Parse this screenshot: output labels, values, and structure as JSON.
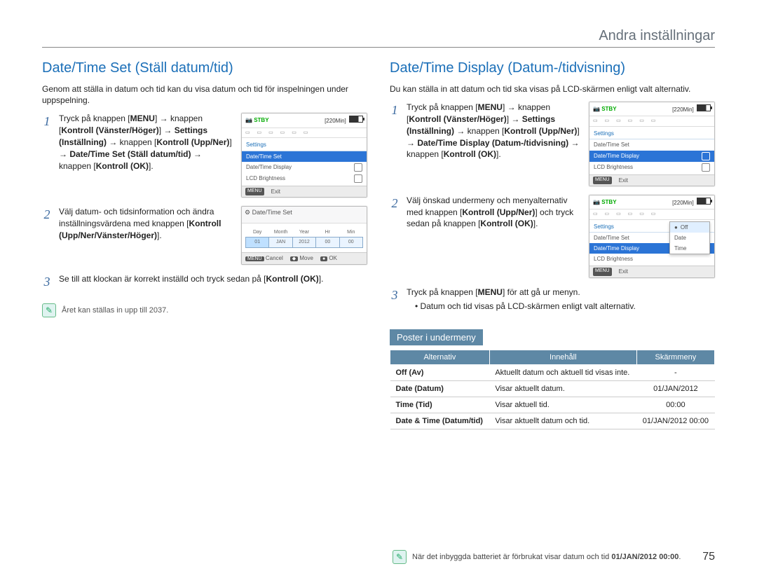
{
  "header": {
    "title": "Andra inställningar"
  },
  "page_number": "75",
  "left": {
    "heading": "Date/Time Set (Ställ datum/tid)",
    "intro": "Genom att ställa in datum och tid kan du visa datum och tid för inspelningen under uppspelning.",
    "steps": {
      "s1": {
        "num": "1",
        "prefix": "Tryck på knappen [",
        "menu": "MENU",
        "mid1": "] → knappen [",
        "k1": "Kontroll (Vänster/Höger)",
        "mid2": "] → ",
        "settings": "Settings (Inställning)",
        "mid3": " → knappen [",
        "k2": "Kontroll (Upp/Ner)",
        "mid4": "] → ",
        "target": "Date/Time Set (Ställ datum/tid)",
        "mid5": " → knappen [",
        "ok": "Kontroll (OK)",
        "tail": "]."
      },
      "s2": {
        "num": "2",
        "text_a": "Välj datum- och tidsinformation och ändra inställningsvärdena med knappen [",
        "kb": "Kontroll (Upp/Ner/Vänster/Höger)",
        "text_b": "]."
      },
      "s3": {
        "num": "3",
        "text_a": "Se till att klockan är korrekt inställd och tryck sedan på [",
        "kb": "Kontroll (OK)",
        "text_b": "]."
      }
    },
    "note": "Året kan ställas in upp till 2037.",
    "lcd1": {
      "stby": "STBY",
      "time": "[220Min]",
      "tab": "Settings",
      "items": [
        "Date/Time Set",
        "Date/Time Display",
        "LCD Brightness"
      ],
      "footer_key": "MENU",
      "footer_txt": "Exit"
    },
    "lcd2": {
      "title": "Date/Time Set",
      "headers": [
        "Day",
        "Month",
        "Year",
        "Hr",
        "Min"
      ],
      "values": [
        "01",
        "JAN",
        "2012",
        "00",
        "00"
      ],
      "footer": {
        "k1": "MENU",
        "t1": "Cancel",
        "k2": "◆",
        "t2": "Move",
        "k3": "●",
        "t3": "OK"
      }
    }
  },
  "right": {
    "heading": "Date/Time Display (Datum-/tidvisning)",
    "intro": "Du kan ställa in att datum och tid ska visas på LCD-skärmen enligt valt alternativ.",
    "steps": {
      "s1": {
        "num": "1",
        "prefix": "Tryck på knappen [",
        "menu": "MENU",
        "mid1": "] → knappen [",
        "k1": "Kontroll (Vänster/Höger)",
        "mid2": "] → ",
        "settings": "Settings (Inställning)",
        "mid3": " → knappen [",
        "k2": "Kontroll (Upp/Ner)",
        "mid4": "] → ",
        "target": "Date/Time Display (Datum-/tidvisning)",
        "mid5": " → knappen [",
        "ok": "Kontroll (OK)",
        "tail": "]."
      },
      "s2": {
        "num": "2",
        "a": "Välj önskad undermeny och menyalternativ med knappen [",
        "b": "Kontroll (Upp/Ner)",
        "c": "] och tryck sedan på knappen [",
        "d": "Kontroll (OK)",
        "e": "]."
      },
      "s3": {
        "num": "3",
        "a": "Tryck på knappen [",
        "b": "MENU",
        "c": "] för att gå ur menyn."
      }
    },
    "bullet": "Datum och tid visas på LCD-skärmen enligt valt alternativ.",
    "subhead": "Poster i undermeny",
    "table": {
      "headers": {
        "c1": "Alternativ",
        "c2": "Innehåll",
        "c3": "Skärmmeny"
      },
      "rows": [
        {
          "alt": "Off (Av)",
          "desc": "Aktuellt datum och aktuell tid visas inte.",
          "scr": "-"
        },
        {
          "alt": "Date (Datum)",
          "desc": "Visar aktuellt datum.",
          "scr": "01/JAN/2012"
        },
        {
          "alt": "Time (Tid)",
          "desc": "Visar aktuell tid.",
          "scr": "00:00"
        },
        {
          "alt": "Date & Time (Datum/tid)",
          "desc": "Visar aktuellt datum och tid.",
          "scr": "01/JAN/2012 00:00"
        }
      ]
    },
    "lcd1": {
      "stby": "STBY",
      "time": "[220Min]",
      "tab": "Settings",
      "items": [
        "Date/Time Set",
        "Date/Time Display",
        "LCD Brightness"
      ],
      "sel_index": 1,
      "footer_key": "MENU",
      "footer_txt": "Exit"
    },
    "lcd2": {
      "stby": "STBY",
      "time": "[220Min]",
      "tab": "Settings",
      "items": [
        "Date/Time Set",
        "Date/Time Display",
        "LCD Brightness"
      ],
      "sel_index": 1,
      "popup": [
        "Off",
        "Date",
        "Time"
      ],
      "popup_sel": 0,
      "footer_key": "MENU",
      "footer_txt": "Exit"
    },
    "footnote_a": "När det inbyggda batteriet är förbrukat visar datum och tid ",
    "footnote_b": "01/JAN/2012 00:00",
    "footnote_c": "."
  }
}
